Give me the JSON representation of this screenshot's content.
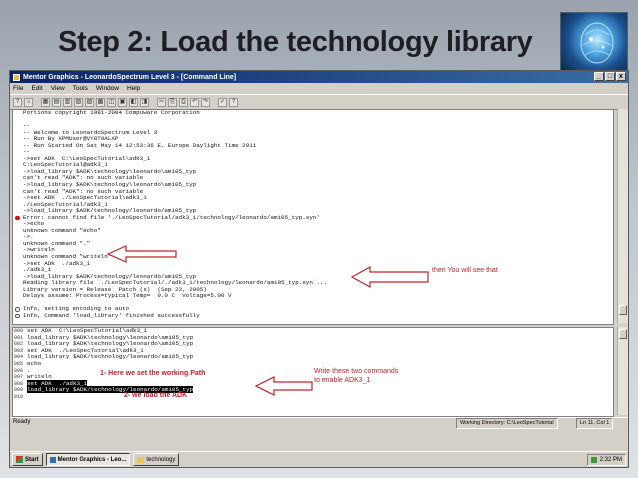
{
  "slide": {
    "title": "Step 2: Load the technology library"
  },
  "window": {
    "title": "Mentor Graphics - LeonardoSpectrum Level 3 - [Command Line]",
    "controls": [
      "_",
      "□",
      "x"
    ]
  },
  "menu": [
    "File",
    "Edit",
    "View",
    "Tools",
    "Window",
    "Help"
  ],
  "toolbar_glyphs": [
    "?",
    "⌂",
    "▦",
    "▤",
    "▥",
    "▧",
    "▨",
    "▩",
    "◫",
    "▣",
    "◧",
    "◨",
    "✂",
    "⎘",
    "⎙",
    "↶",
    "↷",
    "✓",
    "?"
  ],
  "transcript": [
    {
      "text": "Portions copyright 1991-2004 Compuware Corporation",
      "marker": ""
    },
    {
      "text": "",
      "marker": ""
    },
    {
      "text": "--",
      "marker": ""
    },
    {
      "text": "-- Welcome to LeonardoSpectrum Level 3",
      "marker": ""
    },
    {
      "text": "-- Run By XPMUser@VY8T9ALXP",
      "marker": ""
    },
    {
      "text": "-- Run Started On Sat May 14 12:53:36 E. Europe Daylight Time 2011",
      "marker": ""
    },
    {
      "text": "--",
      "marker": ""
    },
    {
      "text": "->set ADK  C:\\LeoSpecTutorial\\adk3_1",
      "marker": ""
    },
    {
      "text": "C:LeoSpecTutorial@adk3_1",
      "marker": ""
    },
    {
      "text": "->load_library $ADK\\technology\\leonardo\\ami05_typ",
      "marker": ""
    },
    {
      "text": "can't read \"ADK\": no such variable",
      "marker": ""
    },
    {
      "text": "->load_library $ADK\\technology\\leonardo\\ami05_typ",
      "marker": ""
    },
    {
      "text": "can't read \"ADK\": no such variable",
      "marker": ""
    },
    {
      "text": "->set ADK  ./LeoSpecTutorial\\adk3_1",
      "marker": ""
    },
    {
      "text": "./LeoSpecTutorial/adk3_1",
      "marker": ""
    },
    {
      "text": "->load_library $ADK/technology/leonardo/ami05_typ",
      "marker": ""
    },
    {
      "text": "Error: cannot find file './LeoSpecTutorial/adk3_1/technology/leonardo/ami05_typ.syn'",
      "marker": "error"
    },
    {
      "text": "->echo",
      "marker": ""
    },
    {
      "text": "unknown command \"echo\"",
      "marker": ""
    },
    {
      "text": "->.",
      "marker": ""
    },
    {
      "text": "unknown command \".\"",
      "marker": ""
    },
    {
      "text": "->writeln",
      "marker": ""
    },
    {
      "text": "unknown command \"writeln\"",
      "marker": ""
    },
    {
      "text": "->set ADK  ./adk3_1",
      "marker": ""
    },
    {
      "text": "./adk3_1",
      "marker": ""
    },
    {
      "text": "->load_library $ADK/technology/leonardo/ami05_typ",
      "marker": ""
    },
    {
      "text": "Reading library file `./LeoSpecTutorial/./adk3_1/technology/leonardo/ami05_typ.syn`...",
      "marker": ""
    },
    {
      "text": "Library version = Release  Patch (s)  (Sep 23, 2005)",
      "marker": ""
    },
    {
      "text": "Delays assume: Process=typical Temp=  0.0 C  Voltage=5.00 V",
      "marker": ""
    },
    {
      "text": "",
      "marker": ""
    },
    {
      "text": "Info, setting encoding to auto",
      "marker": "info"
    },
    {
      "text": "Info, Command 'load_library' finished successfully",
      "marker": "info"
    }
  ],
  "script_lines": [
    {
      "num": "000",
      "text": "set ADK  C:\\LeoSpecTutorial\\adk3_1",
      "highlight": false
    },
    {
      "num": "001",
      "text": "load_library $ADK\\technology\\leonardo\\ami05_typ",
      "highlight": false
    },
    {
      "num": "002",
      "text": "load_library $ADK\\technology\\leonardo\\ami05_typ",
      "highlight": false
    },
    {
      "num": "003",
      "text": "set ADK  ./LeoSpecTutorial\\adk3_1",
      "highlight": false
    },
    {
      "num": "004",
      "text": "load_library $ADK/technology/leonardo/ami05_typ",
      "highlight": false
    },
    {
      "num": "005",
      "text": "echo",
      "highlight": false
    },
    {
      "num": "006",
      "text": ".",
      "highlight": false
    },
    {
      "num": "007",
      "text": "writeln",
      "highlight": false
    },
    {
      "num": "008",
      "text": "set ADK  ./adk3_1",
      "highlight": true
    },
    {
      "num": "009",
      "text": "load_library $ADK/technology/leonardo/ami05_typ",
      "highlight": true
    },
    {
      "num": "010",
      "text": "",
      "highlight": false
    }
  ],
  "status": {
    "ready": "Ready",
    "working_directory": "Working Directory: C:\\LeoSpecTutorial",
    "position": "Ln 11, Col 1"
  },
  "taskbar": {
    "start": "Start",
    "tasks": [
      "Mentor Graphics - Leo...",
      "technology"
    ],
    "clock": "2:32 PM"
  },
  "annotations": {
    "result": "then You will see that",
    "write_line1": "Write these two commands",
    "write_line2": "to enable ADK3_1",
    "step1": "1- Here we set the working Path",
    "step2": "2- we load the ADK"
  },
  "colors": {
    "annotation": "#c0202a",
    "titlebar": "#0a246a",
    "error_marker": "#d01010"
  }
}
